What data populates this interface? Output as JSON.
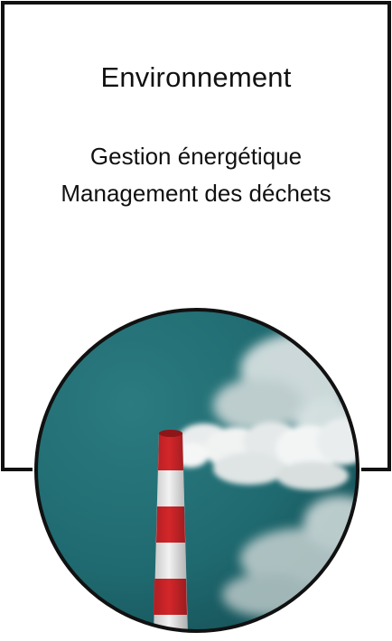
{
  "card": {
    "title": "Environnement",
    "lines": [
      "Gestion énergétique",
      "Management des déchets"
    ]
  },
  "colors": {
    "border": "#111111",
    "sky": "#1f6a70",
    "stack_red": "#d4262a",
    "stack_white": "#f2f2f2",
    "smoke": "#e9ecec"
  },
  "photo": {
    "subject": "factory-chimney-smoke"
  }
}
